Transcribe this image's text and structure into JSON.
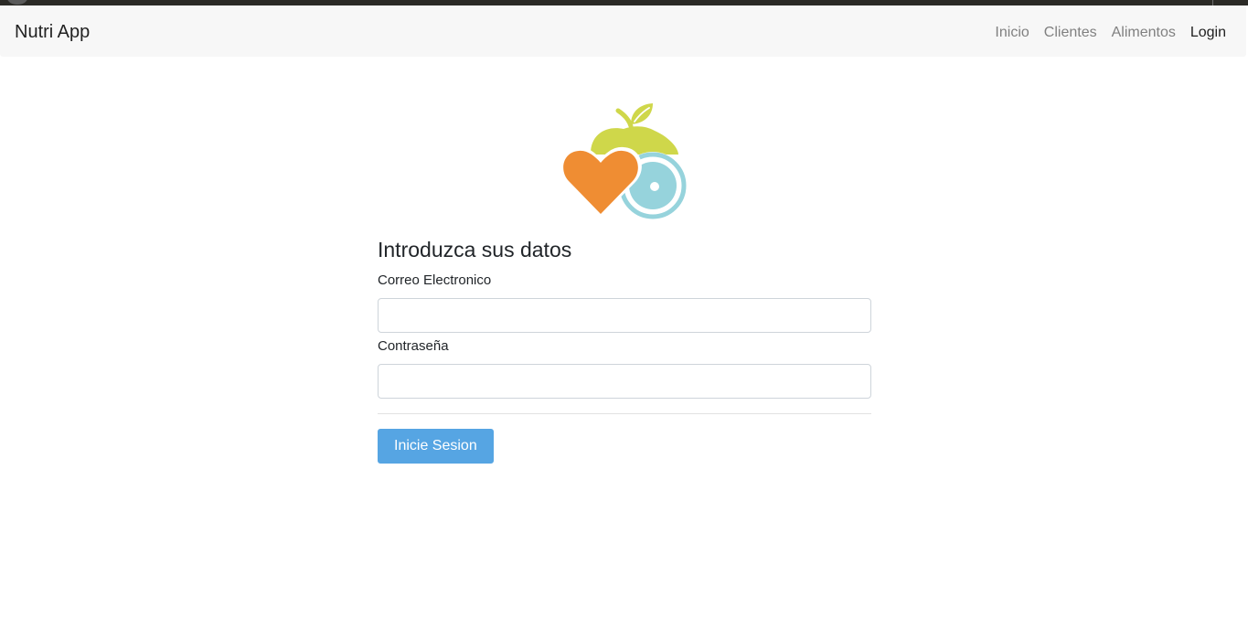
{
  "navbar": {
    "brand": "Nutri App",
    "links": [
      {
        "label": "Inicio",
        "active": false
      },
      {
        "label": "Clientes",
        "active": false
      },
      {
        "label": "Alimentos",
        "active": false
      },
      {
        "label": "Login",
        "active": true
      }
    ]
  },
  "logo": {
    "icon": "nutrition-logo-icon",
    "colors": {
      "heart": "#ef8d33",
      "leaf": "#cfd74a",
      "plate": "#96d3dc"
    }
  },
  "form": {
    "heading": "Introduzca sus datos",
    "email_label": "Correo Electronico",
    "email_value": "",
    "password_label": "Contraseña",
    "password_value": "",
    "submit_label": "Inicie Sesion"
  },
  "colors": {
    "primary_button": "#56a5e3",
    "navbar_bg": "#f7f7f7"
  }
}
